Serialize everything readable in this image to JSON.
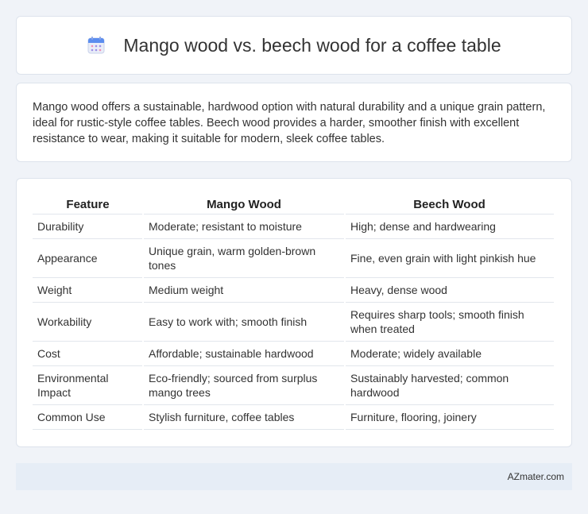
{
  "header": {
    "title": "Mango wood vs. beech wood for a coffee table",
    "icon": "calendar-icon"
  },
  "intro": {
    "text": "Mango wood offers a sustainable, hardwood option with natural durability and a unique grain pattern, ideal for rustic-style coffee tables. Beech wood provides a harder, smoother finish with excellent resistance to wear, making it suitable for modern, sleek coffee tables."
  },
  "table": {
    "headers": [
      "Feature",
      "Mango Wood",
      "Beech Wood"
    ],
    "rows": [
      [
        "Durability",
        "Moderate; resistant to moisture",
        "High; dense and hardwearing"
      ],
      [
        "Appearance",
        "Unique grain, warm golden-brown tones",
        "Fine, even grain with light pinkish hue"
      ],
      [
        "Weight",
        "Medium weight",
        "Heavy, dense wood"
      ],
      [
        "Workability",
        "Easy to work with; smooth finish",
        "Requires sharp tools; smooth finish when treated"
      ],
      [
        "Cost",
        "Affordable; sustainable hardwood",
        "Moderate; widely available"
      ],
      [
        "Environmental Impact",
        "Eco-friendly; sourced from surplus mango trees",
        "Sustainably harvested; common hardwood"
      ],
      [
        "Common Use",
        "Stylish furniture, coffee tables",
        "Furniture, flooring, joinery"
      ]
    ]
  },
  "footer": {
    "site": "AZmater.com"
  }
}
